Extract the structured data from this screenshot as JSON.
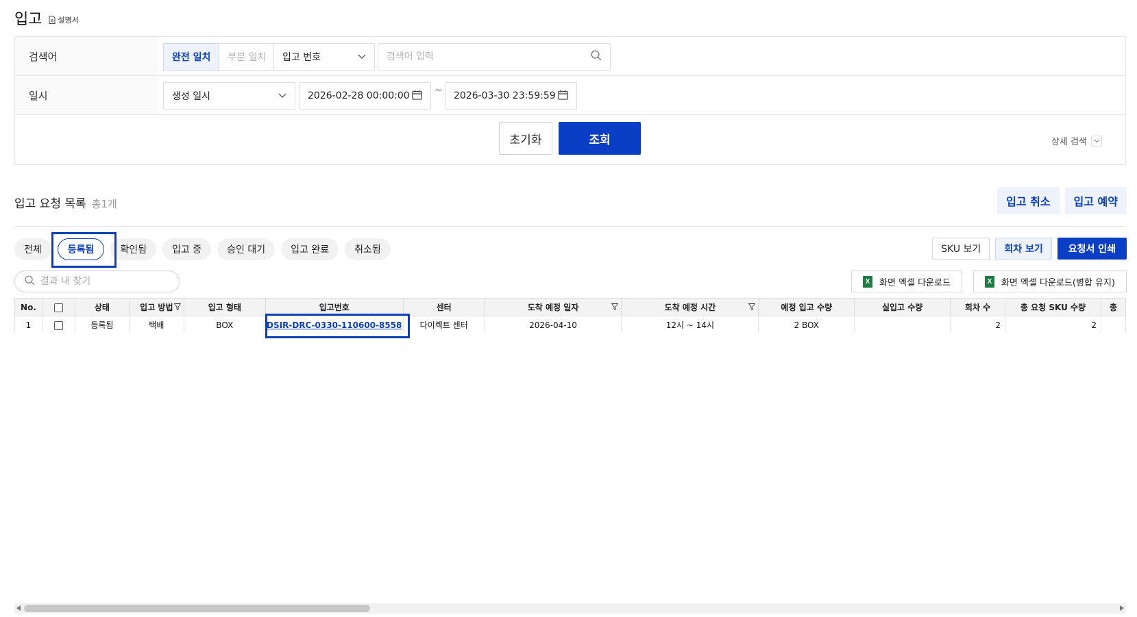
{
  "page": {
    "title": "입고",
    "manual_label": "설명서"
  },
  "search": {
    "keyword_label": "검색어",
    "match_options": [
      "완전 일치",
      "부분 일치"
    ],
    "field_select": "입고 번호",
    "keyword_placeholder": "검색어 입력",
    "date_label": "일시",
    "date_type_select": "생성 일시",
    "date_from": "2026-02-28 00:00:00",
    "date_to": "2026-03-30 23:59:59",
    "tilde": "~",
    "reset_label": "초기화",
    "search_label": "조회",
    "advanced_label": "상세 검색"
  },
  "list": {
    "title": "입고 요청 목록",
    "count": "총1개",
    "cancel_label": "입고 취소",
    "reserve_label": "입고 예약",
    "status_pills": [
      "전체",
      "등록됨",
      "확인됨",
      "입고 중",
      "승인 대기",
      "입고 완료",
      "취소됨"
    ],
    "view_sku_label": "SKU 보기",
    "view_round_label": "회차 보기",
    "print_label": "요청서 인쇄",
    "filter_placeholder": "결과 내 찾기",
    "excel_label": "화면 엑셀 다운로드",
    "excel_merge_label": "화면 엑셀 다운로드(병합 유지)"
  },
  "table": {
    "headers": [
      "No.",
      "",
      "상태",
      "입고 방법",
      "입고 형태",
      "입고번호",
      "센터",
      "도착 예정 일자",
      "도착 예정 시간",
      "예정 입고 수량",
      "실입고 수량",
      "회차 수",
      "총 요청 SKU 수량",
      "총"
    ],
    "rows": [
      {
        "no": "1",
        "status": "등록됨",
        "method": "택배",
        "type": "BOX",
        "inbound_no": "DSIR-DRC-0330-110600-8558",
        "center": "다이렉트 센터",
        "arrival_date": "2026-04-10",
        "arrival_time": "12시 ~ 14시",
        "planned_qty": "2 BOX",
        "actual_qty": "",
        "rounds": "2",
        "total_sku": "2"
      }
    ]
  },
  "colors": {
    "primary": "#0a3fc5",
    "accent_text": "#0a3fb8",
    "soft_bg": "#eef3fb",
    "excel_green": "#1d7a43"
  }
}
